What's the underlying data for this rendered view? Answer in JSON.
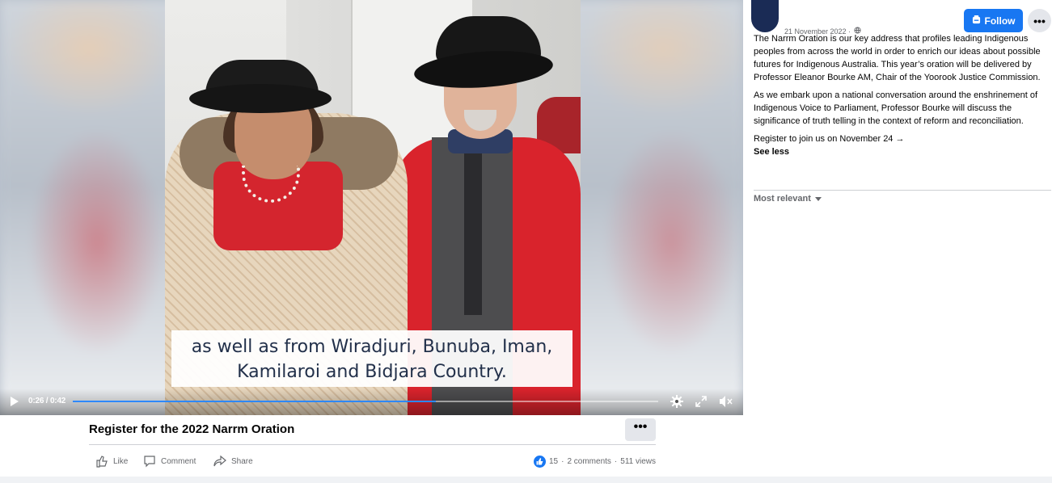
{
  "video": {
    "caption_line1": "as well as from Wiradjuri, Bunuba, Iman,",
    "caption_line2": "Kamilaroi and Bidjara Country.",
    "time": "0:26 / 0:42",
    "progress_fraction": 0.62,
    "controls": {
      "play_icon": "play-icon",
      "settings_icon": "gear-icon",
      "fullscreen_icon": "expand-icon",
      "mute_icon": "speaker-muted-icon"
    }
  },
  "post": {
    "title": "Register for the 2022 Narrm Oration",
    "more_label": "•••",
    "actions": {
      "like": "Like",
      "comment": "Comment",
      "share": "Share"
    },
    "stats": {
      "reactions": "15",
      "comments": "2 comments",
      "views": "511 views",
      "separator": "·"
    }
  },
  "panel": {
    "date": "21 November 2022 ·",
    "follow_label": "Follow",
    "more_label": "•••",
    "paragraph1": "The Narrm Oration is our key address that profiles leading Indigenous peoples from across the world in order to enrich our ideas about possible futures for Indigenous Australia. This year’s oration will be delivered by Professor Eleanor Bourke AM, Chair of the Yoorook Justice Commission.",
    "paragraph2": "As we embark upon a national conversation around the enshrinement of Indigenous Voice to Parliament, Professor Bourke will discuss the significance of truth telling in the context of reform and reconciliation.",
    "paragraph3": "Register to join us on November 24 →",
    "see_less": "See less",
    "sort_label": "Most relevant"
  },
  "colors": {
    "brand_blue": "#1877f2",
    "muted_text": "#65676b",
    "button_grey": "#e4e6eb"
  }
}
